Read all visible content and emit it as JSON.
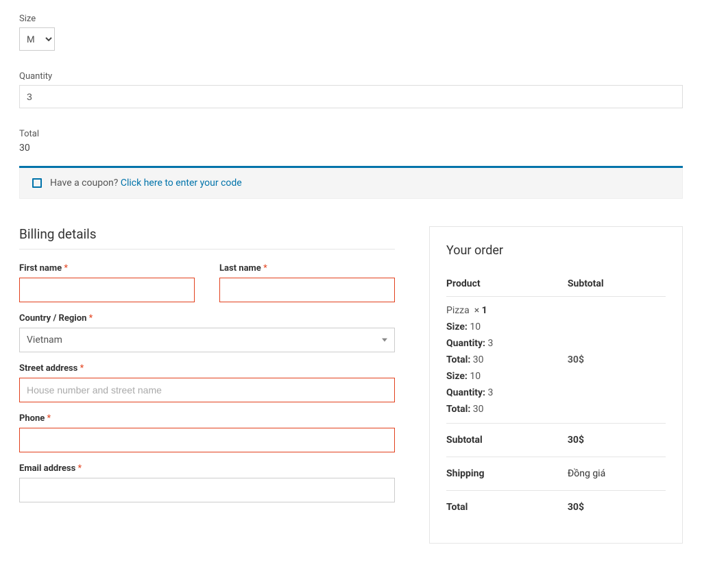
{
  "product_form": {
    "size_label": "Size",
    "size_value": "M",
    "quantity_label": "Quantity",
    "quantity_value": "3",
    "total_label": "Total",
    "total_value": "30"
  },
  "coupon": {
    "prompt": "Have a coupon?",
    "link": "Click here to enter your code"
  },
  "billing": {
    "title": "Billing details",
    "first_name_label": "First name",
    "last_name_label": "Last name",
    "country_label": "Country / Region",
    "country_value": "Vietnam",
    "street_label": "Street address",
    "street_placeholder": "House number and street name",
    "phone_label": "Phone",
    "email_label": "Email address",
    "required_mark": "*"
  },
  "order": {
    "title": "Your order",
    "th_product": "Product",
    "th_subtotal": "Subtotal",
    "line_item_name": "Pizza",
    "line_item_times": "×",
    "line_item_qty": "1",
    "line_item_price": "30$",
    "meta": {
      "size_label_1": "Size:",
      "size_value_1": "10",
      "qty_label_1": "Quantity:",
      "qty_value_1": "3",
      "total_label_1": "Total:",
      "total_value_1": "30",
      "size_label_2": "Size:",
      "size_value_2": "10",
      "qty_label_2": "Quantity:",
      "qty_value_2": "3",
      "total_label_2": "Total:",
      "total_value_2": "30"
    },
    "subtotal_label": "Subtotal",
    "subtotal_value": "30$",
    "shipping_label": "Shipping",
    "shipping_value": "Đồng giá",
    "total_label": "Total",
    "total_value": "30$"
  }
}
